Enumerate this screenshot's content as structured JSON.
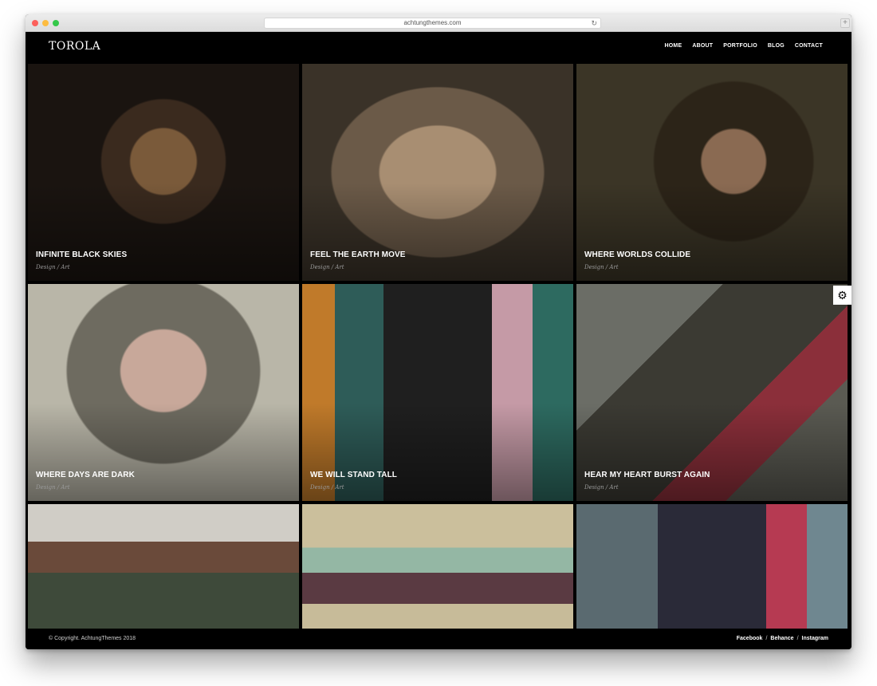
{
  "browser": {
    "url": "achtungthemes.com",
    "reload_icon": "↻",
    "newtab_icon": "+"
  },
  "header": {
    "logo": "TOROLA",
    "nav": [
      "HOME",
      "ABOUT",
      "PORTFOLIO",
      "BLOG",
      "CONTACT"
    ]
  },
  "portfolio": {
    "items": [
      {
        "title": "INFINITE BLACK SKIES",
        "categories": "Design  / Art"
      },
      {
        "title": "FEEL THE EARTH MOVE",
        "categories": "Design  / Art"
      },
      {
        "title": "WHERE WORLDS COLLIDE",
        "categories": "Design  / Art"
      },
      {
        "title": "WHERE DAYS ARE DARK",
        "categories": "Design  / Art"
      },
      {
        "title": "WE WILL STAND TALL",
        "categories": "Design  / Art"
      },
      {
        "title": "HEAR MY HEART BURST AGAIN",
        "categories": "Design  / Art"
      }
    ]
  },
  "settings_icon": "⚙",
  "footer": {
    "copyright": "© Copyright. AchtungThemes 2018",
    "social": [
      "Facebook",
      "Behance",
      "Instagram"
    ],
    "separator": "/"
  }
}
